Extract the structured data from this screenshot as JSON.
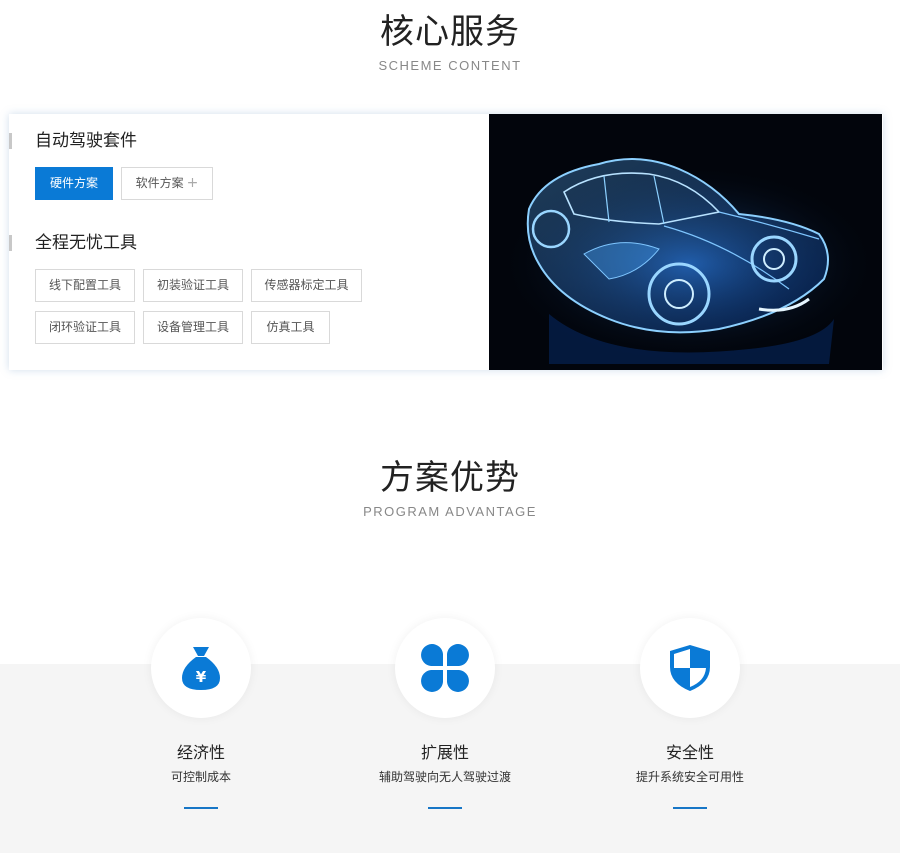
{
  "services": {
    "title": "核心服务",
    "subtitle": "SCHEME CONTENT",
    "group1": {
      "title": "自动驾驶套件",
      "hardware_label": "硬件方案",
      "software_label": "软件方案",
      "software_plus": "+"
    },
    "group2": {
      "title": "全程无忧工具",
      "tools": [
        "线下配置工具",
        "初装验证工具",
        "传感器标定工具",
        "闭环验证工具",
        "设备管理工具",
        "仿真工具"
      ]
    },
    "image": "blue-xray-car-illustration"
  },
  "advantage": {
    "title": "方案优势",
    "subtitle": "PROGRAM ADVANTAGE",
    "items": [
      {
        "icon": "money-bag-icon",
        "title": "经济性",
        "desc": "可控制成本"
      },
      {
        "icon": "four-petal-icon",
        "title": "扩展性",
        "desc": "辅助驾驶向无人驾驶过渡"
      },
      {
        "icon": "shield-icon",
        "title": "安全性",
        "desc": "提升系统安全可用性"
      }
    ]
  },
  "colors": {
    "accent": "#0a7ad6",
    "band_bg": "#f5f5f5"
  }
}
